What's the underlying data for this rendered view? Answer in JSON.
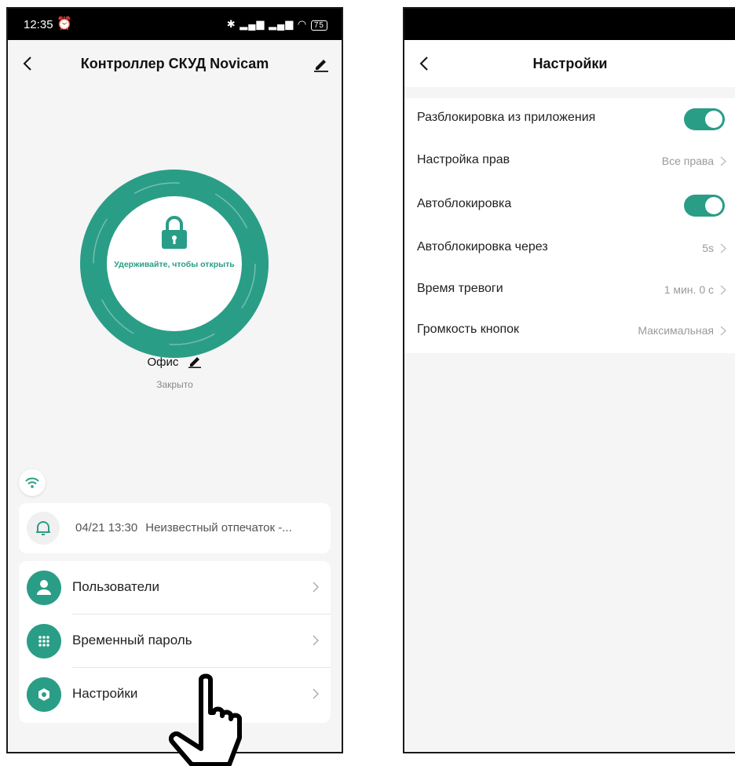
{
  "colors": {
    "accent": "#2a9d87",
    "background": "#f5f5f5"
  },
  "left": {
    "status": {
      "time": "12:35",
      "battery": "75"
    },
    "title": "Контроллер СКУД Novicam",
    "lock_hint": "Удерживайте, чтобы открыть",
    "door_name": "Офис",
    "door_state": "Закрыто",
    "event": {
      "date": "04/21 13:30",
      "text": "Неизвестный отпечаток -..."
    },
    "menu": [
      {
        "label": "Пользователи",
        "icon": "user-icon"
      },
      {
        "label": "Временный пароль",
        "icon": "keypad-icon"
      },
      {
        "label": "Настройки",
        "icon": "gear-icon"
      }
    ]
  },
  "right": {
    "title": "Настройки",
    "settings": [
      {
        "label": "Разблокировка из приложения",
        "toggle": true
      },
      {
        "label": "Настройка прав",
        "value": "Все права"
      },
      {
        "label": "Автоблокировка",
        "toggle": true
      },
      {
        "label": "Автоблокировка через",
        "value": "5s"
      },
      {
        "label": "Время тревоги",
        "value": "1 мин. 0 с"
      },
      {
        "label": "Громкость кнопок",
        "value": "Максимальная"
      }
    ]
  }
}
